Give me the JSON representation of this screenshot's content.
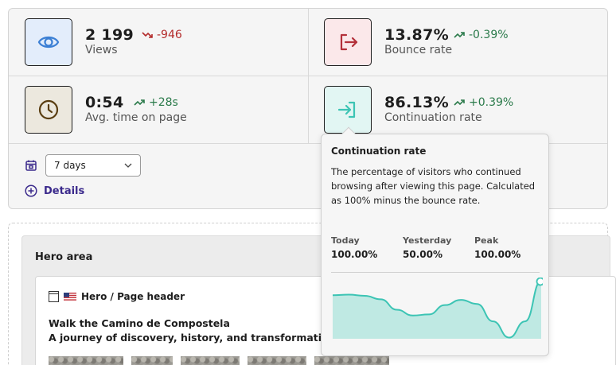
{
  "stats": [
    {
      "value": "2 199",
      "delta": "-946",
      "trend": "down",
      "label": "Views",
      "icon": "eye-icon"
    },
    {
      "value": "13.87%",
      "delta": "-0.39%",
      "trend": "up",
      "label": "Bounce rate",
      "icon": "exit-icon"
    },
    {
      "value": "0:54",
      "delta": "+28s",
      "trend": "up",
      "label": "Avg. time on page",
      "icon": "clock-icon"
    },
    {
      "value": "86.13%",
      "delta": "+0.39%",
      "trend": "up",
      "label": "Continuation rate",
      "icon": "enter-icon"
    }
  ],
  "range": {
    "selected": "7 days"
  },
  "details_label": "Details",
  "hero": {
    "section_title": "Hero area",
    "block_label": "Hero / Page header",
    "headline": "Walk the Camino de Compostela",
    "subline": "A journey of discovery, history, and transformation"
  },
  "tooltip": {
    "title": "Continuation rate",
    "description": "The percentage of visitors who continued browsing after viewing this page. Calculated as 100% minus the bounce rate.",
    "today_label": "Today",
    "today_value": "100.00%",
    "yesterday_label": "Yesterday",
    "yesterday_value": "50.00%",
    "peak_label": "Peak",
    "peak_value": "100.00%"
  },
  "colors": {
    "negative": "#b32a2a",
    "positive": "#2a7a4a",
    "teal": "#3cc4b4",
    "link": "#3b2a8c"
  },
  "chart_data": {
    "type": "area",
    "values": [
      75,
      76,
      74,
      68,
      50,
      40,
      42,
      58,
      67,
      60,
      30,
      2,
      30,
      100
    ]
  }
}
